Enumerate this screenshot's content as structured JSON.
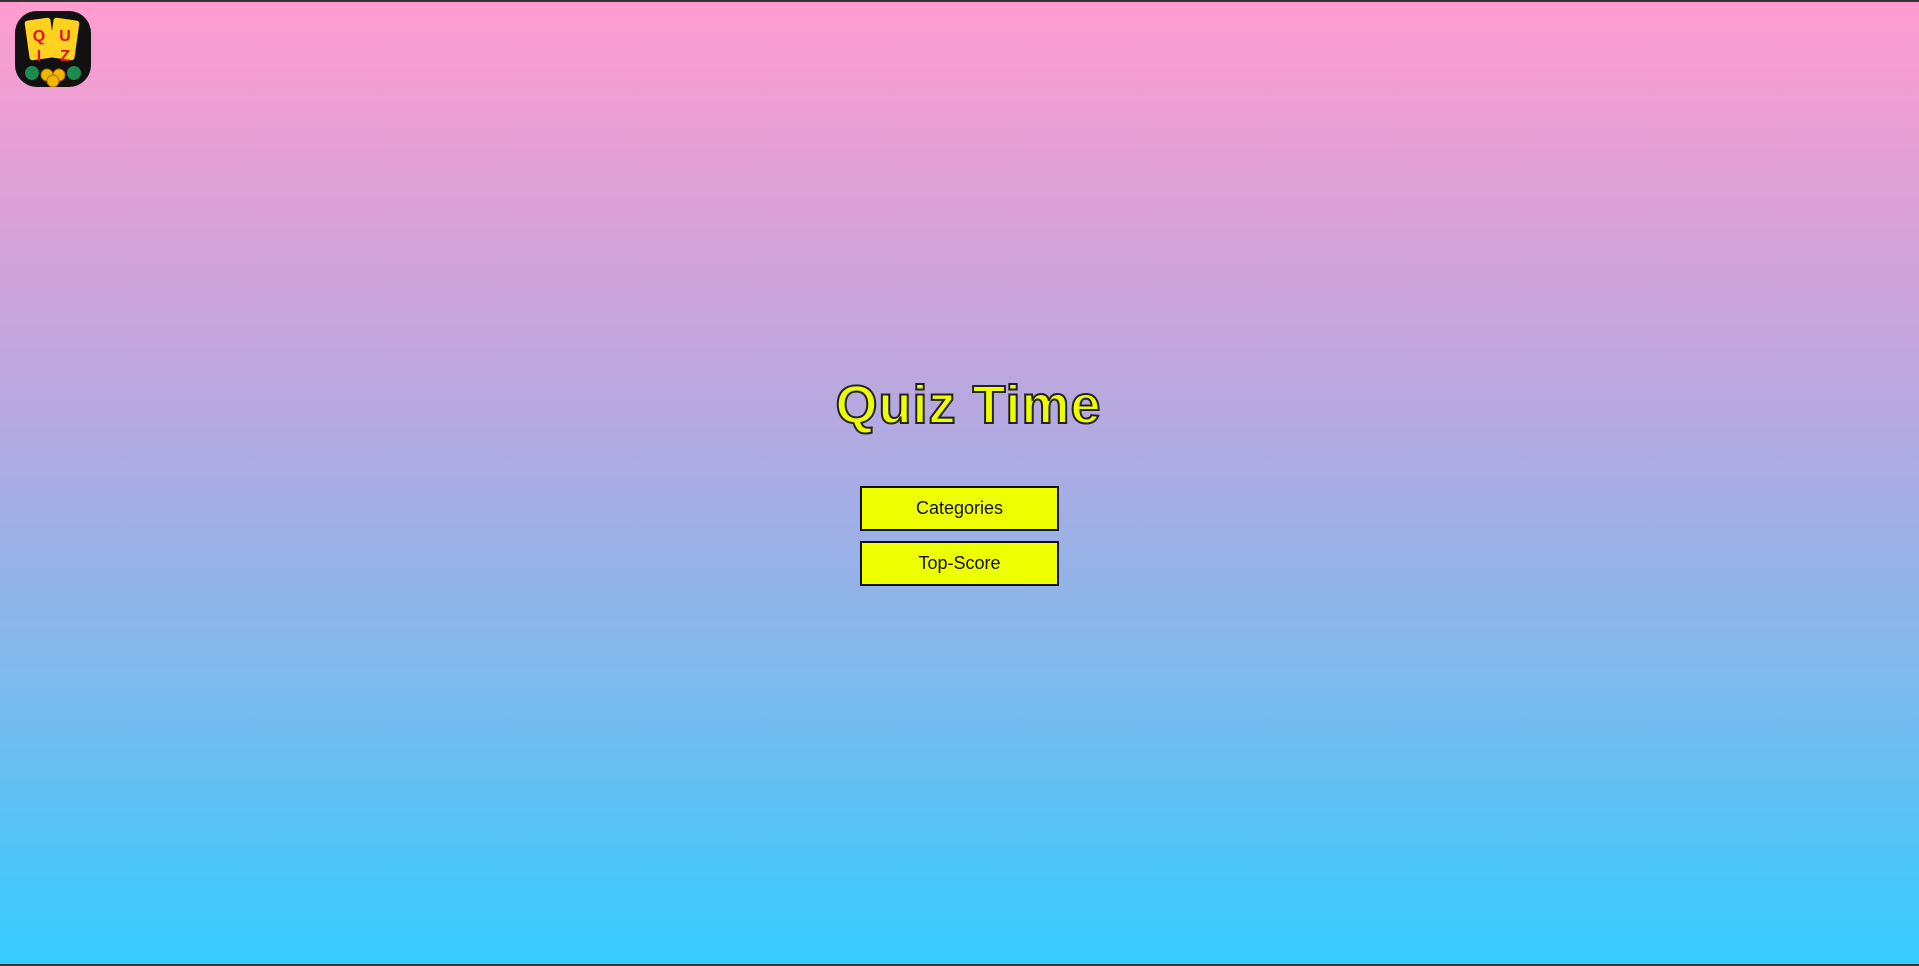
{
  "logo": {
    "icon": "quiz-logo-icon",
    "letters": [
      "Q",
      "U",
      "I",
      "Z"
    ]
  },
  "title": "Quiz Time",
  "menu": {
    "categories_label": "Categories",
    "top_score_label": "Top-Score"
  },
  "colors": {
    "accent": "#eeff00",
    "gradient_top": "#ff9ccf",
    "gradient_bottom": "#36ccff"
  }
}
